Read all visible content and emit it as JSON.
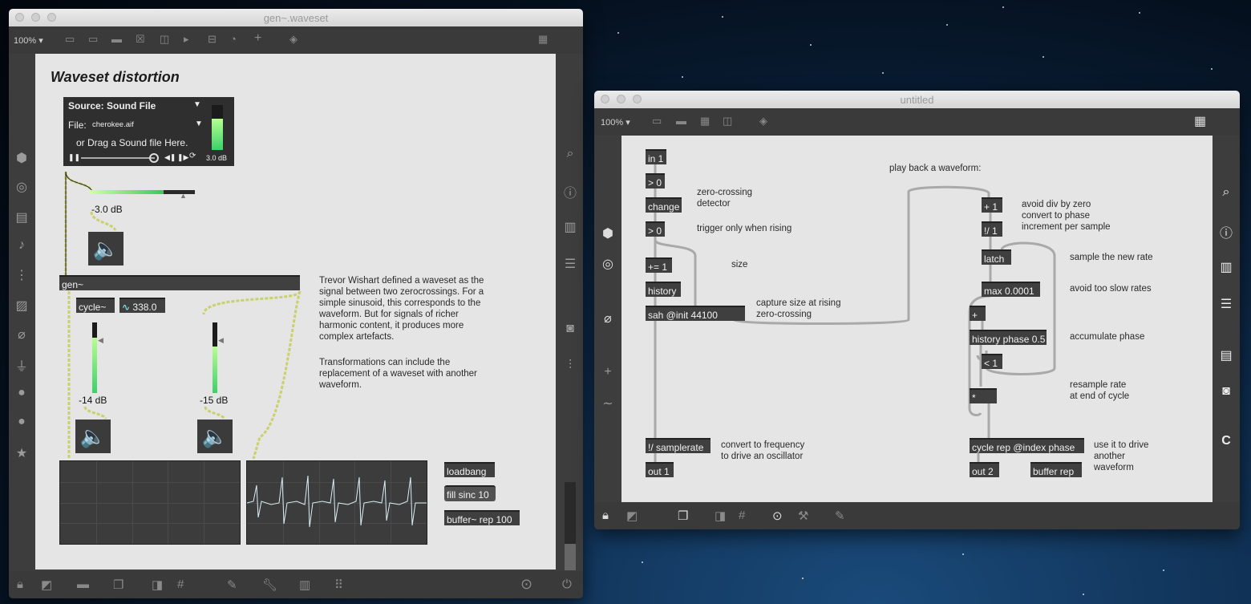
{
  "colors": {
    "wire_audio": "#c8d16a",
    "wire_control": "#a7a7a7",
    "meter_green": "#3bd16a"
  },
  "left_window": {
    "title": "gen~.waveset",
    "zoom": "100%",
    "patch_title": "Waveset distortion",
    "source_panel": {
      "source_label": "Source: Sound File",
      "file_label": "File:",
      "file_name": "cherokee.aif",
      "drag_hint": "or Drag a Sound file Here.",
      "gain_readout": "3.0 dB"
    },
    "gain_main": "-3.0 dB",
    "gen_object": "gen~",
    "cycle_object": "cycle~",
    "freq_number": "338.0",
    "gain_left": "-14 dB",
    "gain_right": "-15 dB",
    "description_1": "Trevor Wishart defined a waveset as the signal between two zerocrossings. For a simple sinusoid, this corresponds to the waveform. But for signals of richer harmonic content, it produces more complex artefacts.",
    "description_2": "Transformations can include the replacement of a waveset with another waveform.",
    "loadbang": "loadbang",
    "fill_msg": "fill sinc 10",
    "buffer_obj": "buffer~ rep 100"
  },
  "right_window": {
    "title": "untitled",
    "zoom": "100%",
    "objects": {
      "in1": "in 1",
      "gt0a": "> 0",
      "change": "change",
      "gt0b": "> 0",
      "pluseq": "+= 1",
      "history": "history",
      "sah": "sah @init 44100",
      "samplerate": "!/ samplerate",
      "out1": "out 1",
      "plus1": "+ 1",
      "rdiv1": "!/ 1",
      "latch": "latch",
      "max": "max 0.0001",
      "plus": "+",
      "historyphase": "history phase 0.5",
      "lt1": "< 1",
      "mult": "*",
      "cyclerep": "cycle rep @index phase",
      "out2": "out 2",
      "bufferrep": "buffer rep"
    },
    "comments": {
      "zero_crossing": "zero-crossing\ndetector",
      "trigger": "trigger only when rising",
      "size": "size",
      "capture": "capture size at rising\nzero-crossing",
      "convert": "convert to frequency\nto drive an oscillator",
      "playback": "play back a waveform:",
      "avoid_div": "avoid div by zero\nconvert to phase\nincrement per sample",
      "sample_rate": "sample the new rate",
      "avoid_slow": "avoid too slow rates",
      "accumulate": "accumulate phase",
      "resample": "resample rate\nat end of cycle",
      "use_it": "use it to drive\nanother\nwaveform"
    }
  }
}
